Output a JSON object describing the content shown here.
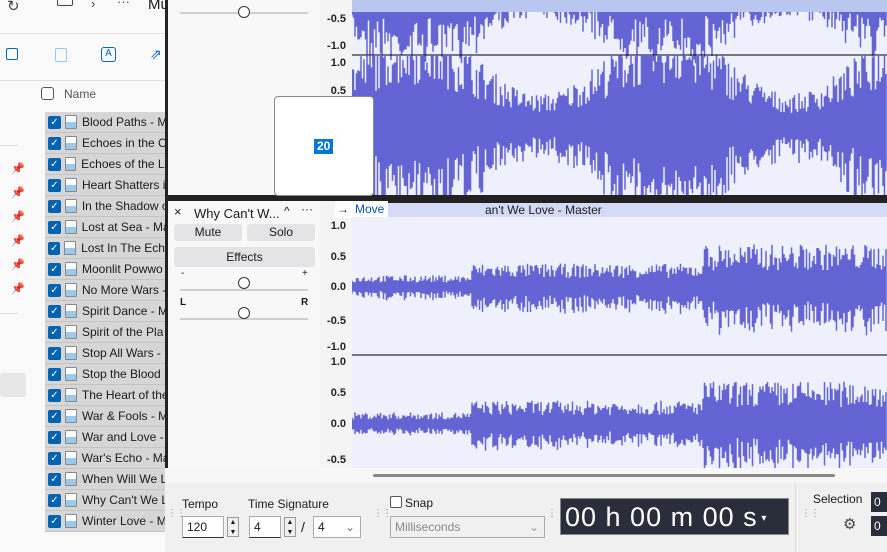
{
  "explorer": {
    "breadcrumb_partial": "Mu",
    "column_header": "Name",
    "files": [
      "Blood Paths - M",
      "Echoes in the C",
      "Echoes of the La",
      "Heart Shatters i",
      "In the Shadow o",
      "Lost at Sea - Ma",
      "Lost In The Echo",
      "Moonlit Powwo",
      "No More Wars -",
      "Spirit Dance - M",
      "Spirit of the Pla",
      "Stop All Wars -",
      "Stop the Blood",
      "The Heart of the",
      "War & Fools - M",
      "War and Love -",
      "War's Echo - Ma",
      "When Will We L",
      "Why Can't We L",
      "Winter Love - M"
    ]
  },
  "popup": {
    "value": "20"
  },
  "track1": {
    "ruler": [
      "-0.5",
      "-1.0",
      "1.0",
      "0.5"
    ]
  },
  "track2": {
    "name": "Why Can't W...",
    "title": "an't We Love - Master",
    "tooltip": "Move",
    "mute": "Mute",
    "solo": "Solo",
    "effects": "Effects",
    "gain_minus": "-",
    "gain_plus": "+",
    "pan_left": "L",
    "pan_right": "R",
    "ruler": [
      "1.0",
      "0.5",
      "0.0",
      "-0.5",
      "-1.0",
      "1.0",
      "0.5",
      "0.0",
      "-0.5"
    ]
  },
  "toolbar": {
    "tempo_label": "Tempo",
    "tempo_value": "120",
    "timesig_label": "Time Signature",
    "timesig_num": "4",
    "timesig_sep": "/",
    "timesig_den": "4",
    "snap_label": "Snap",
    "snap_unit": "Milliseconds",
    "time_display": "00 h 00 m 00 s",
    "selection_label": "Selection",
    "sel_start": "0",
    "sel_end": "0"
  },
  "colors": {
    "waveform": "#6464d4",
    "accent": "#0063b1"
  }
}
